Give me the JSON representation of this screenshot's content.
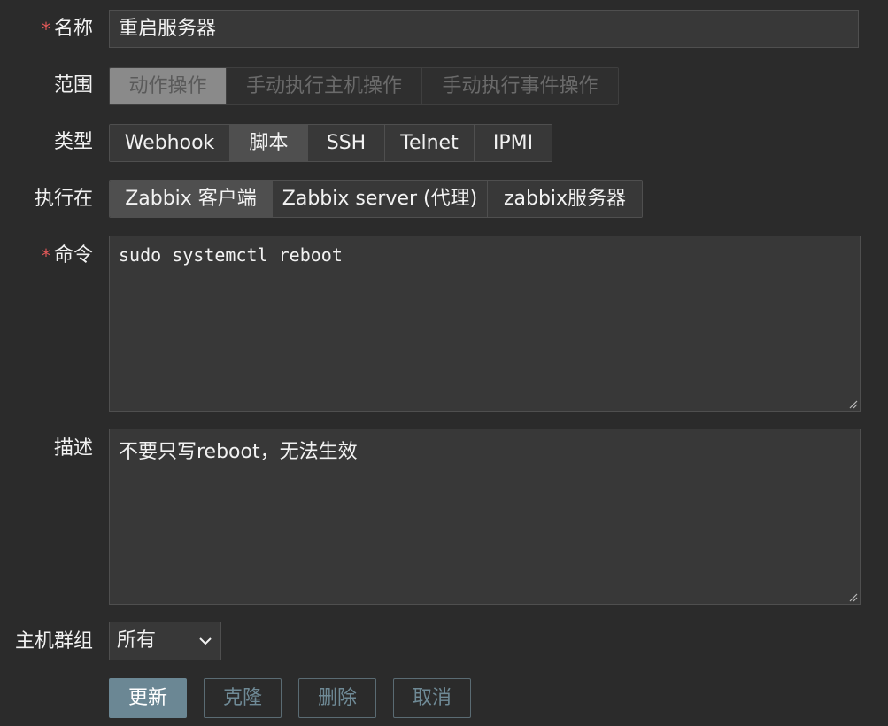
{
  "name": {
    "label": "名称",
    "required_mark": "*",
    "value": "重启服务器"
  },
  "scope": {
    "label": "范围",
    "options": [
      "动作操作",
      "手动执行主机操作",
      "手动执行事件操作"
    ],
    "selected": 0
  },
  "type": {
    "label": "类型",
    "options": [
      "Webhook",
      "脚本",
      "SSH",
      "Telnet",
      "IPMI"
    ],
    "selected": 1
  },
  "execute_on": {
    "label": "执行在",
    "options": [
      "Zabbix 客户端",
      "Zabbix server (代理)",
      "zabbix服务器"
    ],
    "selected": 0
  },
  "command": {
    "label": "命令",
    "required_mark": "*",
    "value": "sudo systemctl reboot"
  },
  "description": {
    "label": "描述",
    "value": "不要只写reboot，无法生效"
  },
  "host_group": {
    "label": "主机群组",
    "value": "所有"
  },
  "buttons": {
    "update": "更新",
    "clone": "克隆",
    "delete": "删除",
    "cancel": "取消"
  },
  "colors": {
    "background": "#2b2b2b",
    "required": "#e45959",
    "primary_button": "#6b8794"
  },
  "icons": {
    "select_arrow": "chevron-down-icon",
    "textarea_resize": "resize-handle-icon"
  }
}
